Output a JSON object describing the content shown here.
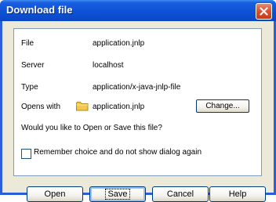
{
  "window": {
    "title": "Download file",
    "close_icon": "close-icon"
  },
  "details": {
    "file_label": "File",
    "file_value": "application.jnlp",
    "server_label": "Server",
    "server_value": "localhost",
    "type_label": "Type",
    "type_value": "application/x-java-jnlp-file",
    "opens_with_label": "Opens with",
    "opens_with_value": "application.jnlp",
    "opens_with_icon": "folder-icon",
    "change_button": "Change..."
  },
  "question": "Would you like to Open or Save this file?",
  "remember": {
    "label": "Remember choice and do not show dialog again",
    "checked": false
  },
  "buttons": {
    "open": "Open",
    "save": "Save",
    "cancel": "Cancel",
    "help": "Help"
  },
  "colors": {
    "title_bar": "#0e52d6",
    "client_bg": "#ece9d8",
    "close_button": "#d9512f"
  }
}
